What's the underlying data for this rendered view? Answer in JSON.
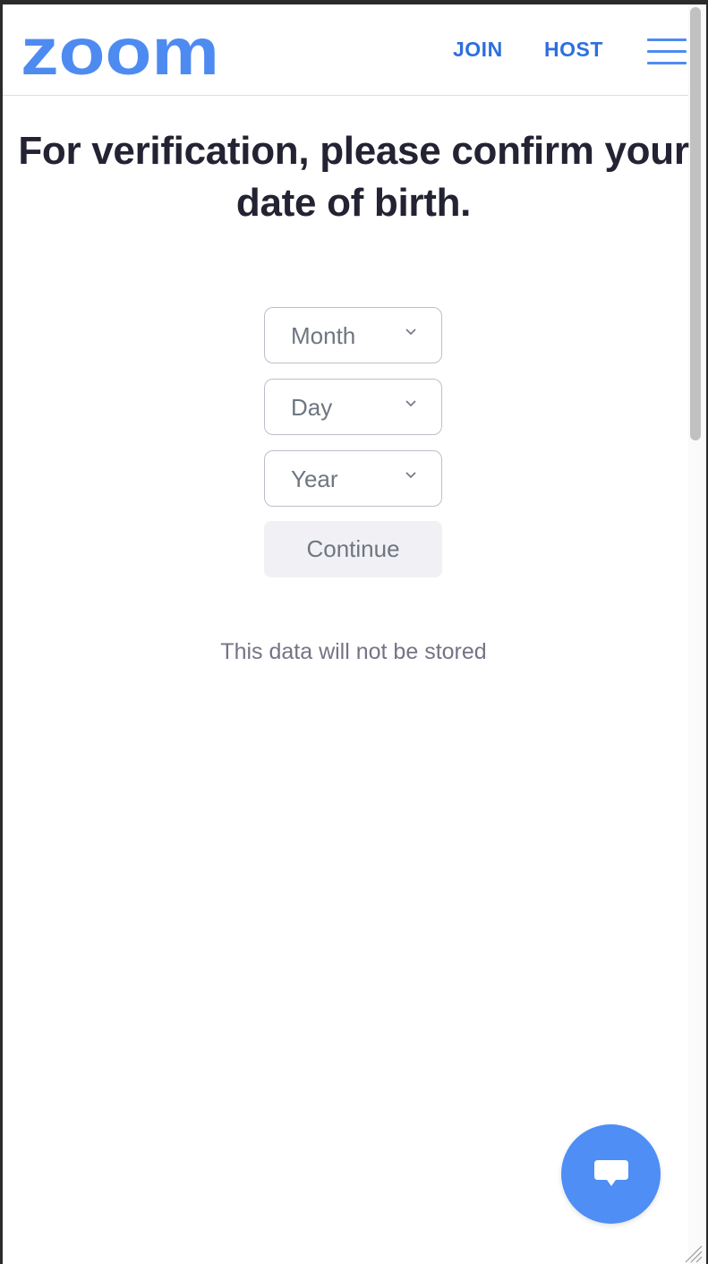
{
  "header": {
    "logo_text": "zoom",
    "nav": {
      "join_label": "JOIN",
      "host_label": "HOST"
    },
    "menu_icon": "hamburger-menu-icon"
  },
  "main": {
    "title": "For verification, please confirm your date of birth.",
    "selects": {
      "month": {
        "value": "Month",
        "icon": "chevron-down-icon"
      },
      "day": {
        "value": "Day",
        "icon": "chevron-down-icon"
      },
      "year": {
        "value": "Year",
        "icon": "chevron-down-icon"
      }
    },
    "continue_label": "Continue",
    "note": "This data will not be stored"
  },
  "chat": {
    "icon": "chat-bubble-icon"
  },
  "colors": {
    "brand": "#4e8bf1",
    "nav_link": "#2d6fdd",
    "title": "#232333",
    "muted_text": "#6e7680",
    "button_bg": "#f1f1f5",
    "chat_fab": "#4e8ef5"
  }
}
